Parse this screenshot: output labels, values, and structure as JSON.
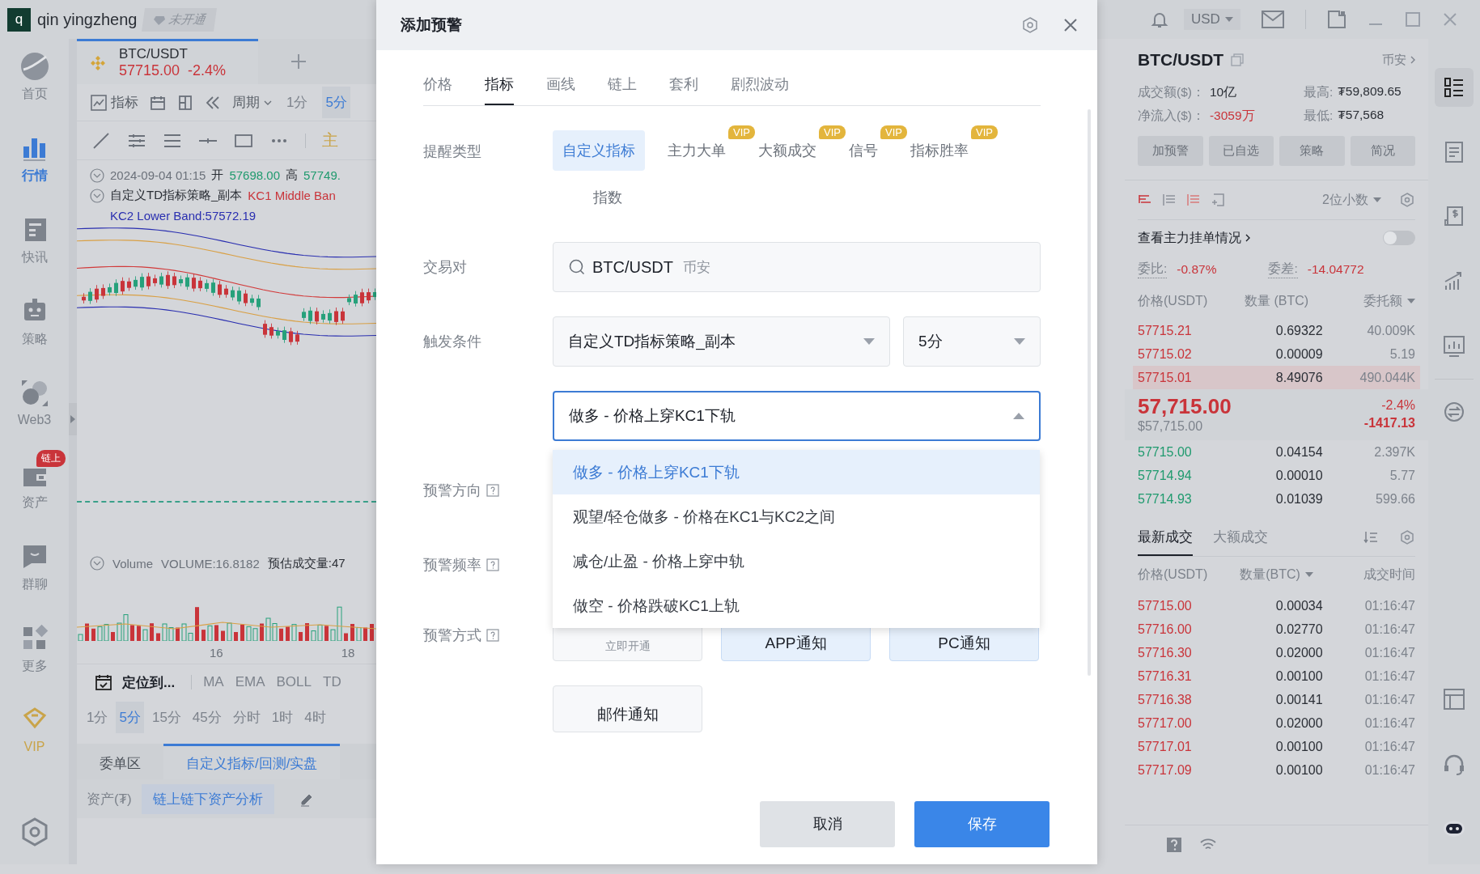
{
  "app_header": {
    "avatar_letter": "q",
    "user": "qin yingzheng",
    "membership": "未开通"
  },
  "top_bar": {
    "currency": "USD"
  },
  "sidebar": {
    "items": [
      {
        "label": "首页",
        "kind": "nav",
        "selected": false
      },
      {
        "label": "行情",
        "kind": "nav",
        "selected": true
      },
      {
        "label": "快讯",
        "kind": "nav",
        "selected": false
      },
      {
        "label": "策略",
        "kind": "nav",
        "selected": false
      },
      {
        "label": "Web3",
        "kind": "nav",
        "selected": false
      },
      {
        "label": "资产",
        "kind": "nav",
        "selected": false,
        "badge": "链上"
      },
      {
        "label": "群聊",
        "kind": "nav",
        "selected": false
      },
      {
        "label": "更多",
        "kind": "nav",
        "selected": false
      },
      {
        "label": "VIP",
        "kind": "vip",
        "selected": false
      }
    ]
  },
  "chart_panel": {
    "tab": {
      "symbol": "BTC/USDT",
      "price": "57715.00",
      "change": "-2.4%"
    },
    "indicator_button": "指标",
    "period_button": "周期",
    "top_periods": [
      {
        "label": "1分",
        "selected": false
      },
      {
        "label": "5分",
        "selected": true
      }
    ],
    "main_label": "主",
    "ohlc": {
      "time": "2024-09-04 01:15",
      "open_label": "开",
      "open": "57698.00",
      "high_label": "高",
      "high": "57749."
    },
    "indicator": {
      "name": "自定义TD指标策略_副本",
      "middle": "KC1 Middle Ban",
      "lower": "KC2 Lower Band:57572.19"
    },
    "volume": {
      "name": "Volume",
      "value": "VOLUME:16.8182",
      "estimate": "预估成交量:47"
    },
    "x_labels": [
      "16",
      "18"
    ],
    "locate": "定位到...",
    "indicators": [
      "MA",
      "EMA",
      "BOLL",
      "TD"
    ],
    "periods": [
      {
        "label": "1分",
        "selected": false
      },
      {
        "label": "5分",
        "selected": true
      },
      {
        "label": "15分",
        "selected": false
      },
      {
        "label": "45分",
        "selected": false
      },
      {
        "label": "分时",
        "selected": false
      },
      {
        "label": "1时",
        "selected": false
      },
      {
        "label": "4时",
        "selected": false
      }
    ],
    "bottom_tabs": [
      {
        "label": "委单区",
        "selected": false
      },
      {
        "label": "自定义指标/回测/实盘",
        "selected": true
      }
    ],
    "asset_label": "资产(₮)",
    "asset_link": "链上链下资产分析"
  },
  "modal": {
    "title": "添加预警",
    "tabs": [
      {
        "label": "价格",
        "selected": false
      },
      {
        "label": "指标",
        "selected": true
      },
      {
        "label": "画线",
        "selected": false
      },
      {
        "label": "链上",
        "selected": false
      },
      {
        "label": "套利",
        "selected": false
      },
      {
        "label": "剧烈波动",
        "selected": false
      }
    ],
    "alert_type": {
      "label": "提醒类型",
      "options": [
        {
          "label": "自定义指标",
          "selected": true
        },
        {
          "label": "主力大单",
          "selected": false,
          "badge": "VIP"
        },
        {
          "label": "大额成交",
          "selected": false,
          "badge": "VIP"
        },
        {
          "label": "信号",
          "selected": false,
          "badge": "VIP"
        },
        {
          "label": "指标胜率",
          "selected": false,
          "badge": "VIP"
        },
        {
          "label": "指数",
          "selected": false
        }
      ]
    },
    "pair": {
      "label": "交易对",
      "value": "BTC/USDT",
      "exchange": "币安"
    },
    "trigger": {
      "label": "触发条件",
      "strategy": "自定义TD指标策略_副本",
      "period": "5分",
      "condition": "做多 - 价格上穿KC1下轨",
      "expanded": true,
      "options": [
        {
          "label": "做多 - 价格上穿KC1下轨",
          "selected": true
        },
        {
          "label": "观望/轻仓做多 - 价格在KC1与KC2之间",
          "selected": false
        },
        {
          "label": "减仓/止盈 - 价格上穿中轨",
          "selected": false
        },
        {
          "label": "做空 - 价格跌破KC1上轨",
          "selected": false
        }
      ]
    },
    "direction_label": "预警方向",
    "frequency_label": "预警频率",
    "method": {
      "label": "预警方式",
      "options": [
        {
          "sub": "立即开通",
          "selected": false
        },
        {
          "label": "APP通知",
          "selected": true
        },
        {
          "label": "PC通知",
          "selected": true
        },
        {
          "label": "邮件通知",
          "selected": false
        }
      ]
    },
    "buttons": [
      {
        "label": "取消",
        "kind": "secondary"
      },
      {
        "label": "保存",
        "kind": "primary"
      }
    ]
  },
  "right_panel": {
    "symbol": "BTC/USDT",
    "exchange": "币安",
    "stats": [
      {
        "label": "成交额($)：",
        "value": "10亿",
        "color": "#2a2e35"
      },
      {
        "label": "最高:",
        "value": "₮59,809.65",
        "color": "#2a2e35"
      },
      {
        "label": "净流入($)：",
        "value": "-3059万",
        "color": "#c9343a"
      },
      {
        "label": "最低:",
        "value": "₮57,568",
        "color": "#2a2e35"
      }
    ],
    "actions": [
      "加预警",
      "已自选",
      "策略",
      "简况"
    ],
    "precision": "2位小数",
    "main_orders_link": "查看主力挂单情况",
    "main_orders_on": false,
    "ratio_label": "委比:",
    "ratio": "-0.87%",
    "diff_label": "委差:",
    "diff": "-14.04772",
    "book_columns": [
      "价格(USDT)",
      "数量 (BTC)",
      "委托额"
    ],
    "asks": [
      {
        "price": "57715.21",
        "amount": "0.69322",
        "total": "40.009K",
        "highlighted": false
      },
      {
        "price": "57715.02",
        "amount": "0.00009",
        "total": "5.19",
        "highlighted": false
      },
      {
        "price": "57715.01",
        "amount": "8.49076",
        "total": "490.044K",
        "highlighted": true
      }
    ],
    "last_price": "57,715.00",
    "last_usd": "$57,715.00",
    "change_pct": "-2.4%",
    "change_abs": "-1417.13",
    "bids": [
      {
        "price": "57715.00",
        "amount": "0.04154",
        "total": "2.397K"
      },
      {
        "price": "57714.94",
        "amount": "0.00010",
        "total": "5.77"
      },
      {
        "price": "57714.93",
        "amount": "0.01039",
        "total": "599.66"
      }
    ],
    "trade_tabs": [
      {
        "label": "最新成交",
        "selected": true
      },
      {
        "label": "大额成交",
        "selected": false
      }
    ],
    "trade_columns": [
      "价格(USDT)",
      "数量(BTC)",
      "成交时间"
    ],
    "trades": [
      {
        "price": "57715.00",
        "amount": "0.00034",
        "time": "01:16:47"
      },
      {
        "price": "57716.00",
        "amount": "0.02770",
        "time": "01:16:47"
      },
      {
        "price": "57716.30",
        "amount": "0.02000",
        "time": "01:16:47"
      },
      {
        "price": "57716.31",
        "amount": "0.00100",
        "time": "01:16:47"
      },
      {
        "price": "57716.38",
        "amount": "0.00141",
        "time": "01:16:47"
      },
      {
        "price": "57717.00",
        "amount": "0.02000",
        "time": "01:16:47"
      },
      {
        "price": "57717.01",
        "amount": "0.00100",
        "time": "01:16:47"
      },
      {
        "price": "57717.09",
        "amount": "0.00100",
        "time": "01:16:47"
      }
    ]
  }
}
